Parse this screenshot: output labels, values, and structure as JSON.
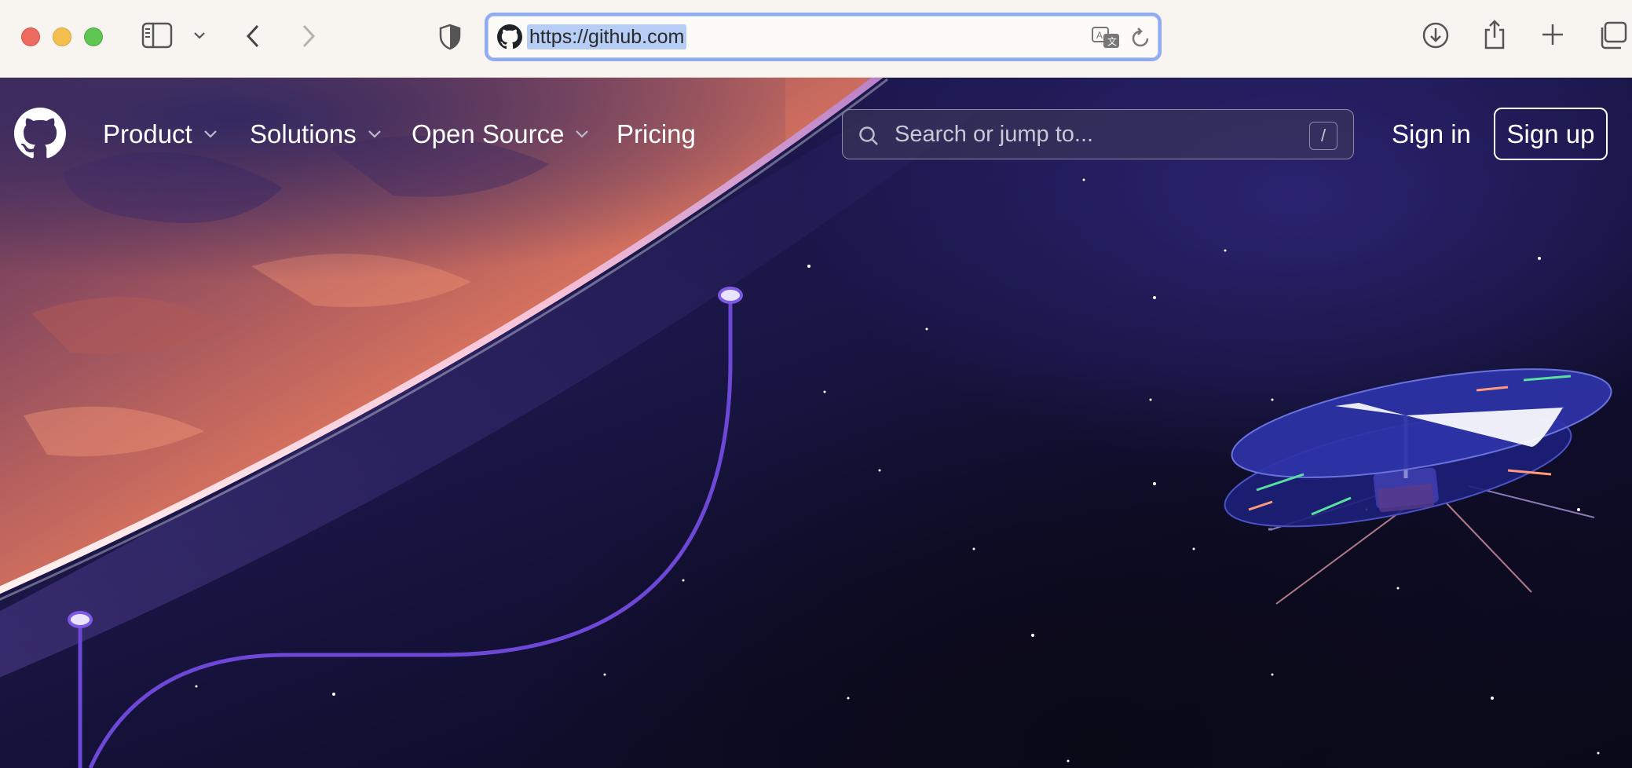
{
  "browser": {
    "url": "https://github.com",
    "icons": {
      "sidebar": "sidebar-icon",
      "sidebar_menu": "chevron-down-icon",
      "back": "chevron-left-icon",
      "forward": "chevron-right-icon",
      "privacy": "shield-icon",
      "favicon": "github-icon",
      "translate": "translate-icon",
      "reload": "reload-icon",
      "download": "download-icon",
      "share": "share-icon",
      "new_tab": "plus-icon",
      "tabs": "tabs-overview-icon"
    }
  },
  "header": {
    "nav": [
      {
        "label": "Product",
        "has_menu": true
      },
      {
        "label": "Solutions",
        "has_menu": true
      },
      {
        "label": "Open Source",
        "has_menu": true
      },
      {
        "label": "Pricing",
        "has_menu": false
      }
    ],
    "search": {
      "placeholder": "Search or jump to...",
      "shortcut": "/"
    },
    "sign_in": "Sign in",
    "sign_up": "Sign up"
  },
  "colors": {
    "hero_bg": "#1a1647",
    "planet": "#d9735e",
    "atmosphere": "#ffffff",
    "path_line": "#6d47d6",
    "helicopter": "#3a3aa8",
    "url_highlight": "#b6cdf5",
    "url_focus_ring": "#8fabf2"
  }
}
